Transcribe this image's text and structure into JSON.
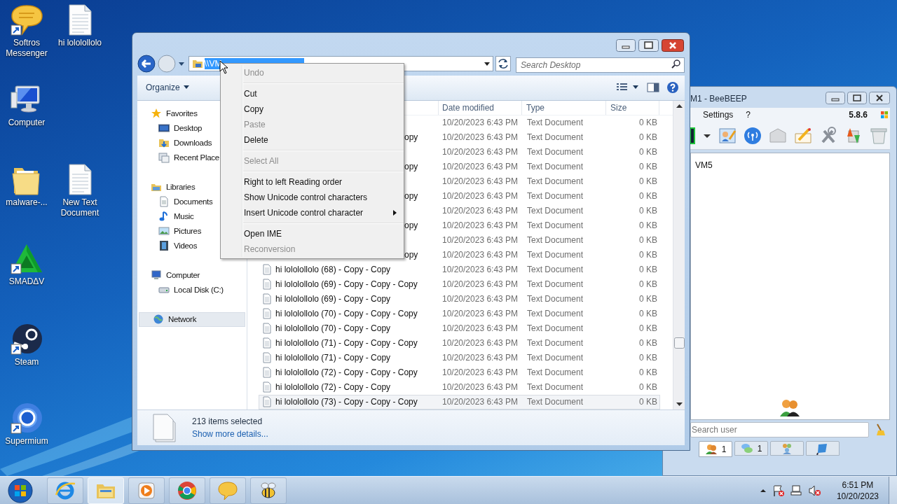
{
  "desktop_icons": [
    {
      "label": "Softros Messenger",
      "kind": "messenger",
      "shortcut": true
    },
    {
      "label": "hi lololollolo",
      "kind": "textfile",
      "shortcut": false
    },
    {
      "label": "Computer",
      "kind": "computer",
      "shortcut": false
    },
    {
      "label": "malware-...",
      "kind": "folder",
      "shortcut": false
    },
    {
      "label": "New Text Document",
      "kind": "textfile",
      "shortcut": false
    },
    {
      "label": "SMADΔV",
      "kind": "smadav",
      "shortcut": true
    },
    {
      "label": "Steam",
      "kind": "steam",
      "shortcut": true
    },
    {
      "label": "Supermium",
      "kind": "supermium",
      "shortcut": true
    }
  ],
  "explorer": {
    "address": "\\\\VM",
    "search_placeholder": "Search Desktop",
    "organize": "Organize",
    "sidebar": [
      {
        "label": "Favorites",
        "kind": "star",
        "selected": false,
        "children": [
          {
            "label": "Desktop",
            "kind": "desktop",
            "selected": false
          },
          {
            "label": "Downloads",
            "kind": "downloads",
            "selected": false
          },
          {
            "label": "Recent Place",
            "kind": "recent",
            "selected": false
          }
        ]
      },
      {
        "label": "Libraries",
        "kind": "library",
        "selected": false,
        "children": [
          {
            "label": "Documents",
            "kind": "documents",
            "selected": false
          },
          {
            "label": "Music",
            "kind": "music",
            "selected": false
          },
          {
            "label": "Pictures",
            "kind": "pictures",
            "selected": false
          },
          {
            "label": "Videos",
            "kind": "videos",
            "selected": false
          }
        ]
      },
      {
        "label": "Computer",
        "kind": "computer",
        "selected": false,
        "children": [
          {
            "label": "Local Disk (C:)",
            "kind": "disk",
            "selected": false
          }
        ]
      },
      {
        "label": "Network",
        "kind": "network",
        "selected": true
      }
    ],
    "columns": [
      "Date modified",
      "Type",
      "Size"
    ],
    "rows": [
      {
        "kind": "hidden",
        "date": "10/20/2023 6:43 PM",
        "type": "Text Document",
        "size": "0 KB",
        "selected": false
      },
      {
        "kind": "partial",
        "name": "opy",
        "date": "10/20/2023 6:43 PM",
        "type": "Text Document",
        "size": "0 KB",
        "selected": false
      },
      {
        "kind": "hidden",
        "date": "10/20/2023 6:43 PM",
        "type": "Text Document",
        "size": "0 KB",
        "selected": false
      },
      {
        "kind": "partial",
        "name": "opy",
        "date": "10/20/2023 6:43 PM",
        "type": "Text Document",
        "size": "0 KB",
        "selected": false
      },
      {
        "kind": "hidden",
        "date": "10/20/2023 6:43 PM",
        "type": "Text Document",
        "size": "0 KB",
        "selected": false
      },
      {
        "kind": "partial",
        "name": "opy",
        "date": "10/20/2023 6:43 PM",
        "type": "Text Document",
        "size": "0 KB",
        "selected": false
      },
      {
        "kind": "hidden",
        "date": "10/20/2023 6:43 PM",
        "type": "Text Document",
        "size": "0 KB",
        "selected": false
      },
      {
        "kind": "partial",
        "name": "opy",
        "date": "10/20/2023 6:43 PM",
        "type": "Text Document",
        "size": "0 KB",
        "selected": false
      },
      {
        "kind": "hidden",
        "date": "10/20/2023 6:43 PM",
        "type": "Text Document",
        "size": "0 KB",
        "selected": false
      },
      {
        "kind": "partial",
        "name": "opy",
        "date": "10/20/2023 6:43 PM",
        "type": "Text Document",
        "size": "0 KB",
        "selected": false
      },
      {
        "kind": "full",
        "name": "hi lololollolo (68) - Copy - Copy",
        "date": "10/20/2023 6:43 PM",
        "type": "Text Document",
        "size": "0 KB",
        "selected": false
      },
      {
        "kind": "full",
        "name": "hi lololollolo (69) - Copy - Copy - Copy",
        "date": "10/20/2023 6:43 PM",
        "type": "Text Document",
        "size": "0 KB",
        "selected": false
      },
      {
        "kind": "full",
        "name": "hi lololollolo (69) - Copy - Copy",
        "date": "10/20/2023 6:43 PM",
        "type": "Text Document",
        "size": "0 KB",
        "selected": false
      },
      {
        "kind": "full",
        "name": "hi lololollolo (70) - Copy - Copy - Copy",
        "date": "10/20/2023 6:43 PM",
        "type": "Text Document",
        "size": "0 KB",
        "selected": false
      },
      {
        "kind": "full",
        "name": "hi lololollolo (70) - Copy - Copy",
        "date": "10/20/2023 6:43 PM",
        "type": "Text Document",
        "size": "0 KB",
        "selected": false
      },
      {
        "kind": "full",
        "name": "hi lololollolo (71) - Copy - Copy - Copy",
        "date": "10/20/2023 6:43 PM",
        "type": "Text Document",
        "size": "0 KB",
        "selected": false
      },
      {
        "kind": "full",
        "name": "hi lololollolo (71) - Copy - Copy",
        "date": "10/20/2023 6:43 PM",
        "type": "Text Document",
        "size": "0 KB",
        "selected": false
      },
      {
        "kind": "full",
        "name": "hi lololollolo (72) - Copy - Copy - Copy",
        "date": "10/20/2023 6:43 PM",
        "type": "Text Document",
        "size": "0 KB",
        "selected": false
      },
      {
        "kind": "full",
        "name": "hi lololollolo (72) - Copy - Copy",
        "date": "10/20/2023 6:43 PM",
        "type": "Text Document",
        "size": "0 KB",
        "selected": false
      },
      {
        "kind": "full",
        "name": "hi lololollolo (73) - Copy - Copy - Copy",
        "date": "10/20/2023 6:43 PM",
        "type": "Text Document",
        "size": "0 KB",
        "selected": true
      }
    ],
    "details": {
      "count": "213 items selected",
      "link": "Show more details..."
    }
  },
  "context_menu": [
    {
      "kind": "item",
      "label": "Undo",
      "disabled": true
    },
    {
      "kind": "separator"
    },
    {
      "kind": "item",
      "label": "Cut",
      "disabled": false
    },
    {
      "kind": "item",
      "label": "Copy",
      "disabled": false
    },
    {
      "kind": "item",
      "label": "Paste",
      "disabled": true
    },
    {
      "kind": "item",
      "label": "Delete",
      "disabled": false
    },
    {
      "kind": "separator"
    },
    {
      "kind": "item",
      "label": "Select All",
      "disabled": true
    },
    {
      "kind": "separator"
    },
    {
      "kind": "item",
      "label": "Right to left Reading order",
      "disabled": false
    },
    {
      "kind": "item",
      "label": "Show Unicode control characters",
      "disabled": false
    },
    {
      "kind": "submenu",
      "label": "Insert Unicode control character",
      "disabled": false
    },
    {
      "kind": "separator"
    },
    {
      "kind": "item",
      "label": "Open IME",
      "disabled": false
    },
    {
      "kind": "item",
      "label": "Reconversion",
      "disabled": true
    }
  ],
  "beebeep": {
    "title": "M1 - BeeBEEP",
    "menu": [
      "Settings",
      "?"
    ],
    "version": "5.8.6",
    "user": "VM5",
    "search_placeholder": "Search user",
    "tabs": [
      {
        "kind": "users",
        "count": "1",
        "selected": true
      },
      {
        "kind": "chats",
        "count": "1",
        "selected": false
      },
      {
        "kind": "groups",
        "selected": false
      },
      {
        "kind": "flag",
        "selected": false
      }
    ]
  },
  "taskbar": {
    "apps": [
      {
        "kind": "ie",
        "active": false
      },
      {
        "kind": "explorer",
        "active": true
      },
      {
        "kind": "media",
        "active": false
      },
      {
        "kind": "chrome",
        "active": false
      },
      {
        "kind": "messenger",
        "active": false
      },
      {
        "kind": "bee",
        "active": false
      }
    ],
    "clock": {
      "time": "6:51 PM",
      "date": "10/20/2023"
    }
  }
}
